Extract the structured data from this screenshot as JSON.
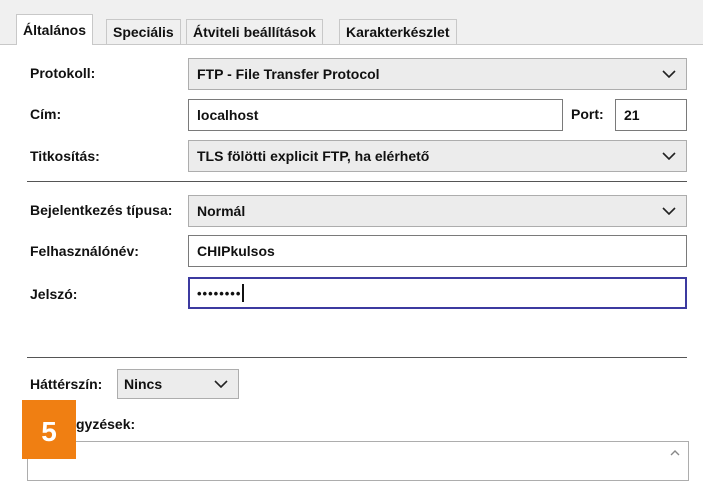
{
  "tabs": [
    {
      "label": "Általános",
      "active": true
    },
    {
      "label": "Speciális",
      "active": false
    },
    {
      "label": "Átviteli beállítások",
      "active": false
    },
    {
      "label": "Karakterkészlet",
      "active": false
    }
  ],
  "form": {
    "protocol_label": "Protokoll:",
    "protocol_value": "FTP - File Transfer Protocol",
    "host_label": "Cím:",
    "host_value": "localhost",
    "port_label": "Port:",
    "port_value": "21",
    "encryption_label": "Titkosítás:",
    "encryption_value": "TLS fölötti explicit FTP, ha elérhető",
    "logon_type_label": "Bejelentkezés típusa:",
    "logon_type_value": "Normál",
    "user_label": "Felhasználónév:",
    "user_value": "CHIPkulsos",
    "password_label": "Jelszó:",
    "password_value": "••••••••",
    "bgcolor_label": "Háttérszín:",
    "bgcolor_value": "Nincs",
    "comments_label": "gyzések:"
  },
  "badge": {
    "number": "5",
    "color": "#f07f12"
  },
  "colors": {
    "focus_border": "#3c3aa0",
    "separator": "#555555"
  }
}
